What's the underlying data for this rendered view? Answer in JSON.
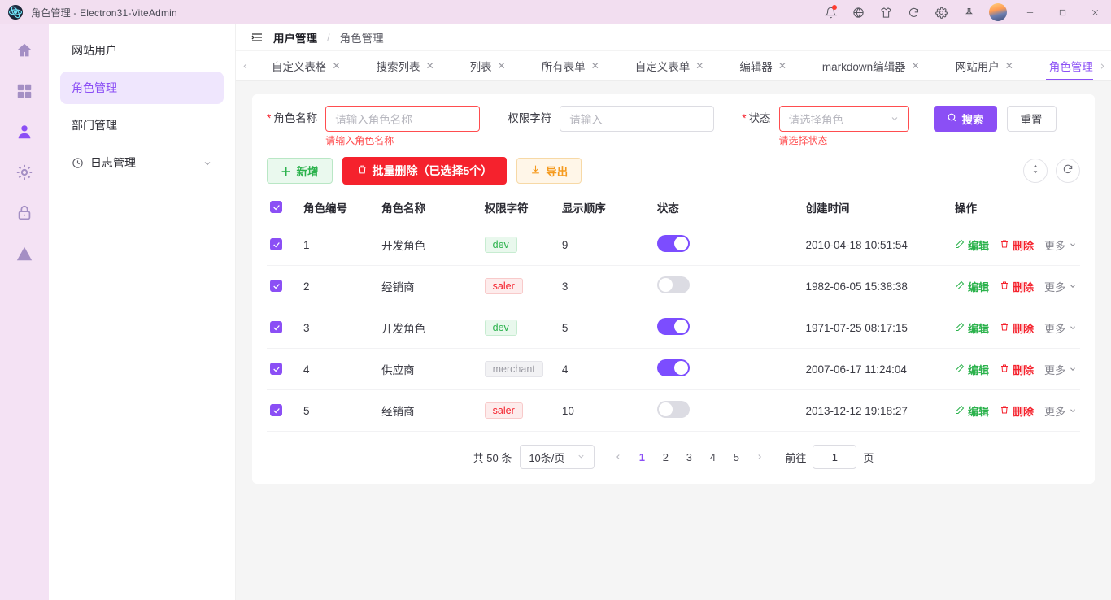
{
  "titlebar": {
    "app_title": "角色管理 - Electron31-ViteAdmin",
    "icons": [
      "bell-icon",
      "globe-icon",
      "theme-shirt-icon",
      "refresh-icon",
      "gear-icon",
      "pin-icon"
    ],
    "window_controls": [
      "minimize",
      "maximize",
      "close"
    ]
  },
  "rail": {
    "items": [
      {
        "name": "home-icon"
      },
      {
        "name": "dashboard-icon"
      },
      {
        "name": "user-icon"
      },
      {
        "name": "settings-icon"
      },
      {
        "name": "lock-icon"
      },
      {
        "name": "warning-icon"
      }
    ]
  },
  "submenu": {
    "items": [
      {
        "label": "网站用户",
        "active": false,
        "icon": null,
        "expandable": false
      },
      {
        "label": "角色管理",
        "active": true,
        "icon": null,
        "expandable": false
      },
      {
        "label": "部门管理",
        "active": false,
        "icon": null,
        "expandable": false
      },
      {
        "label": "日志管理",
        "active": false,
        "icon": "clock-icon",
        "expandable": true
      }
    ]
  },
  "breadcrumb": {
    "parent": "用户管理",
    "separator": "/",
    "current": "角色管理"
  },
  "tabs": [
    {
      "label": "自定义表格",
      "active": false
    },
    {
      "label": "搜索列表",
      "active": false
    },
    {
      "label": "列表",
      "active": false
    },
    {
      "label": "所有表单",
      "active": false
    },
    {
      "label": "自定义表单",
      "active": false
    },
    {
      "label": "编辑器",
      "active": false
    },
    {
      "label": "markdown编辑器",
      "active": false
    },
    {
      "label": "网站用户",
      "active": false
    },
    {
      "label": "角色管理",
      "active": true
    }
  ],
  "search_form": {
    "fields": [
      {
        "label": "角色名称",
        "required": true,
        "type": "input",
        "value": "",
        "placeholder": "请输入角色名称",
        "error": "请输入角色名称"
      },
      {
        "label": "权限字符",
        "required": false,
        "type": "input",
        "value": "",
        "placeholder": "请输入",
        "error": ""
      },
      {
        "label": "状态",
        "required": true,
        "type": "select",
        "value": "",
        "placeholder": "请选择角色",
        "error": "请选择状态"
      }
    ],
    "search_label": "搜索",
    "reset_label": "重置"
  },
  "actionbar": {
    "add_label": "新增",
    "batch_delete_label": "批量删除（已选择5个）",
    "export_label": "导出",
    "density_icon": "sort-density-icon",
    "refresh_icon": "refresh-icon"
  },
  "table": {
    "select_all": true,
    "columns": [
      "角色编号",
      "角色名称",
      "权限字符",
      "显示顺序",
      "状态",
      "创建时间",
      "操作"
    ],
    "rows": [
      {
        "checked": true,
        "id": "1",
        "role_name": "开发角色",
        "perm": "dev",
        "perm_style": "green",
        "order": "9",
        "status": true,
        "created": "2010-04-18 10:51:54"
      },
      {
        "checked": true,
        "id": "2",
        "role_name": "经销商",
        "perm": "saler",
        "perm_style": "red",
        "order": "3",
        "status": false,
        "created": "1982-06-05 15:38:38"
      },
      {
        "checked": true,
        "id": "3",
        "role_name": "开发角色",
        "perm": "dev",
        "perm_style": "green",
        "order": "5",
        "status": true,
        "created": "1971-07-25 08:17:15"
      },
      {
        "checked": true,
        "id": "4",
        "role_name": "供应商",
        "perm": "merchant",
        "perm_style": "gray",
        "order": "4",
        "status": true,
        "created": "2007-06-17 11:24:04"
      },
      {
        "checked": true,
        "id": "5",
        "role_name": "经销商",
        "perm": "saler",
        "perm_style": "red",
        "order": "10",
        "status": false,
        "created": "2013-12-12 19:18:27"
      }
    ],
    "ops": {
      "edit": "编辑",
      "delete": "删除",
      "more": "更多"
    }
  },
  "pagination": {
    "total_text": "共 50 条",
    "page_size": "10条/页",
    "pages": [
      "1",
      "2",
      "3",
      "4",
      "5"
    ],
    "current_page": "1",
    "jump_label": "前往",
    "jump_value": "1",
    "jump_unit": "页"
  },
  "colors": {
    "accent": "#8b4ff5",
    "switch_on": "#7c4dff",
    "danger": "#f5222d",
    "success": "#2bb24c",
    "warning": "#f59a1e",
    "titlebar_bg": "#f2def0",
    "rail_bg": "#f4e2f4",
    "page_bg": "#f5f5f5"
  }
}
